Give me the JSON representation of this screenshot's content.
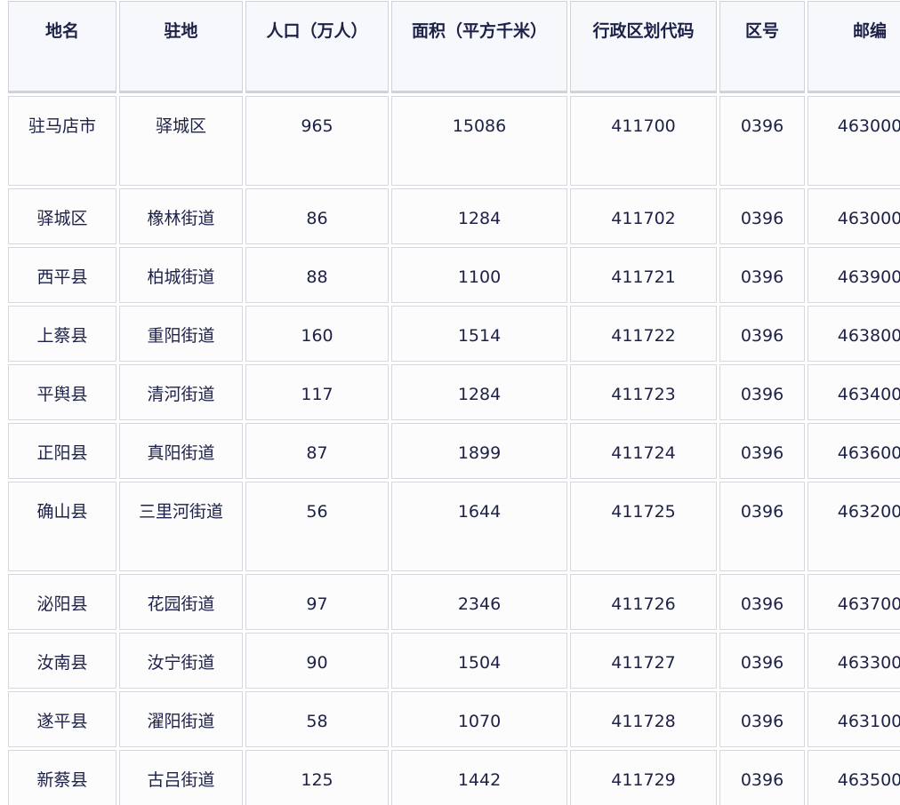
{
  "table": {
    "headers": [
      "地名",
      "驻地",
      "人口（万人）",
      "面积（平方千米）",
      "行政区划代码",
      "区号",
      "邮编"
    ],
    "rows": [
      [
        "驻马店市",
        "驿城区",
        "965",
        "15086",
        "411700",
        "0396",
        "463000"
      ],
      [
        "驿城区",
        "橡林街道",
        "86",
        "1284",
        "411702",
        "0396",
        "463000"
      ],
      [
        "西平县",
        "柏城街道",
        "88",
        "1100",
        "411721",
        "0396",
        "463900"
      ],
      [
        "上蔡县",
        "重阳街道",
        "160",
        "1514",
        "411722",
        "0396",
        "463800"
      ],
      [
        "平舆县",
        "清河街道",
        "117",
        "1284",
        "411723",
        "0396",
        "463400"
      ],
      [
        "正阳县",
        "真阳街道",
        "87",
        "1899",
        "411724",
        "0396",
        "463600"
      ],
      [
        "确山县",
        "三里河街道",
        "56",
        "1644",
        "411725",
        "0396",
        "463200"
      ],
      [
        "泌阳县",
        "花园街道",
        "97",
        "2346",
        "411726",
        "0396",
        "463700"
      ],
      [
        "汝南县",
        "汝宁街道",
        "90",
        "1504",
        "411727",
        "0396",
        "463300"
      ],
      [
        "遂平县",
        "濯阳街道",
        "58",
        "1070",
        "411728",
        "0396",
        "463100"
      ],
      [
        "新蔡县",
        "古吕街道",
        "125",
        "1442",
        "411729",
        "0396",
        "463500"
      ]
    ]
  }
}
